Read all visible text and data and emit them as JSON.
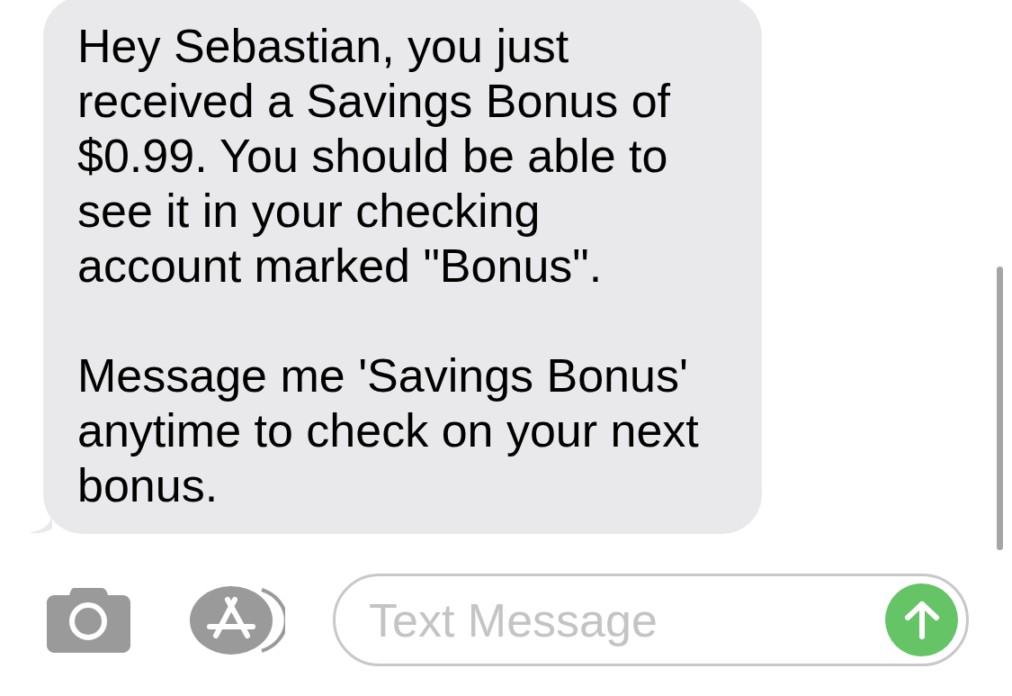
{
  "messages": [
    {
      "kind": "received",
      "paragraphs": [
        "Hey Sebastian, you just received a Savings Bonus of $0.99. You should be able to see it in your checking account marked \"Bonus\".",
        "Message me 'Savings Bonus' anytime to check on your next bonus."
      ]
    }
  ],
  "composer": {
    "placeholder": "Text Message"
  }
}
